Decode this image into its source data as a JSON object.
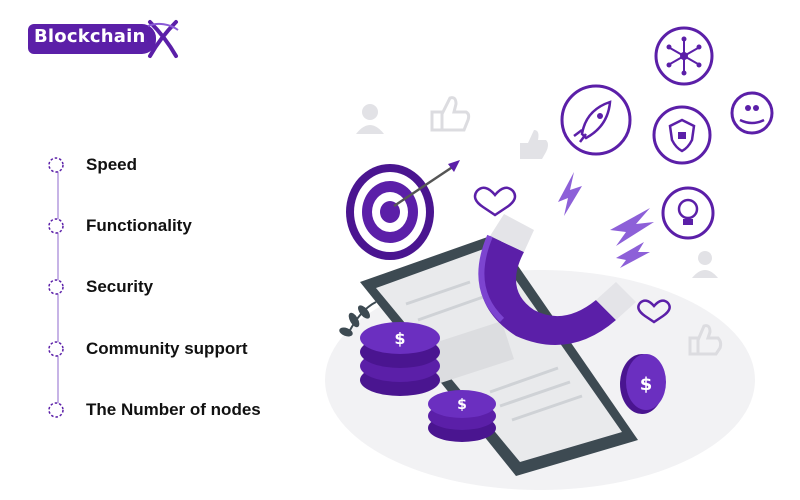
{
  "logo": {
    "text": "Blockchain",
    "brand_color": "#5b1fa8"
  },
  "criteria": {
    "items": [
      {
        "label": "Speed"
      },
      {
        "label": "Functionality"
      },
      {
        "label": "Security"
      },
      {
        "label": "Community support"
      },
      {
        "label": "The Number of nodes"
      }
    ],
    "marker_color": "#5b1fa8",
    "line_color": "#c7b4e6"
  },
  "illustration": {
    "icons": [
      "rocket-icon",
      "network-icon",
      "shield-icon",
      "bulb-icon",
      "hand-people-icon",
      "target-icon",
      "magnet-icon",
      "phone-icon",
      "coin-dollar-icon",
      "heart-icon",
      "thumbs-up-icon",
      "person-icon",
      "lightning-icon"
    ],
    "accent_color": "#5b1fa8"
  }
}
